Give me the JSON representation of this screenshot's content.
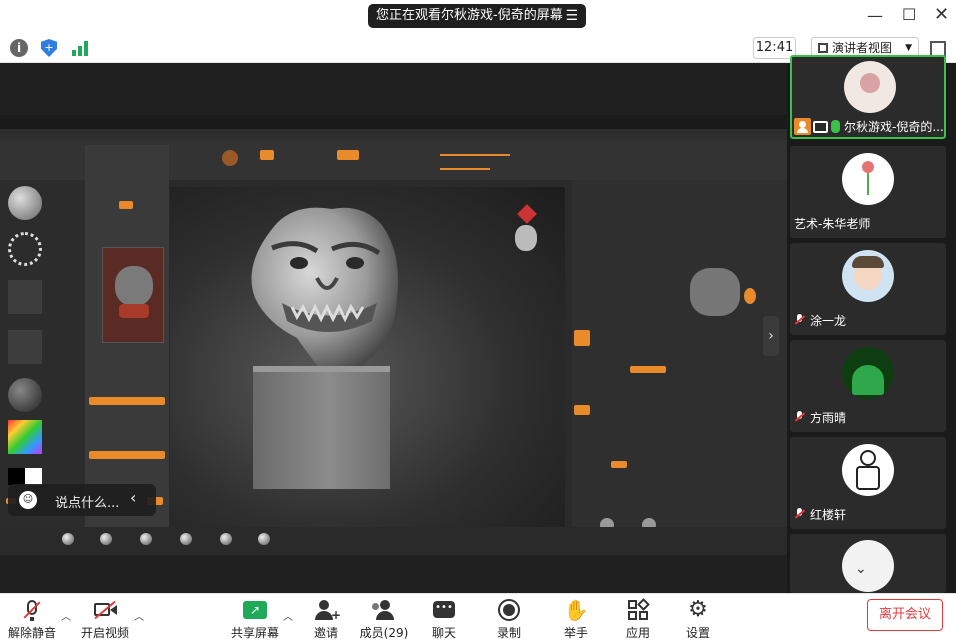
{
  "titlebar": {
    "title": "您正在观看尔秋游戏-倪奇的屏幕",
    "menu_icon": "list-icon"
  },
  "toolbar": {
    "time": "12:41",
    "view_mode": "演讲者视图"
  },
  "shared_screen": {
    "chat_placeholder": "说点什么..."
  },
  "participants": [
    {
      "name": "尔秋游戏-倪奇的...",
      "role": "host",
      "mic": "on",
      "sharing": true
    },
    {
      "name": "艺术-朱华老师",
      "mic": "none"
    },
    {
      "name": "涂一龙",
      "mic": "muted"
    },
    {
      "name": "方雨晴",
      "mic": "muted"
    },
    {
      "name": "红楼轩",
      "mic": "muted"
    },
    {
      "name": "",
      "mic": "none"
    }
  ],
  "bottombar": {
    "unmute": "解除静音",
    "video": "开启视频",
    "share": "共享屏幕",
    "invite": "邀请",
    "members": "成员(29)",
    "chat": "聊天",
    "record": "录制",
    "raise_hand": "举手",
    "apps": "应用",
    "settings": "设置",
    "leave": "离开会议"
  },
  "colors": {
    "accent_green": "#3bc14a",
    "leave_red": "#e03b3b",
    "zbrush_orange": "#e98b2a"
  }
}
